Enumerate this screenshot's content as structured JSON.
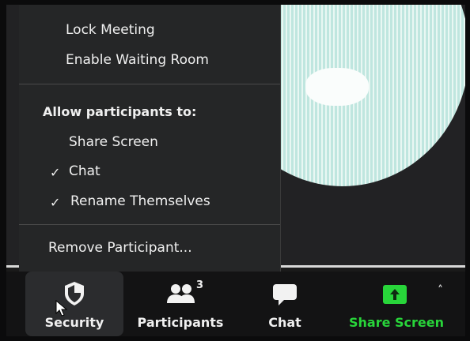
{
  "menu": {
    "lock_meeting": "Lock Meeting",
    "enable_waiting_room": "Enable Waiting Room",
    "allow_heading": "Allow participants to:",
    "share_screen": "Share Screen",
    "chat": "Chat",
    "rename_themselves": "Rename Themselves",
    "remove_participant": "Remove Participant...",
    "checks": {
      "share_screen": false,
      "chat": true,
      "rename_themselves": true
    },
    "check_glyph": "✓"
  },
  "toolbar": {
    "security": {
      "label": "Security",
      "icon": "shield-icon"
    },
    "participants": {
      "label": "Participants",
      "count": "3",
      "icon": "people-icon"
    },
    "chat": {
      "label": "Chat",
      "icon": "speech-bubble-icon"
    },
    "share_screen": {
      "label": "Share Screen",
      "icon": "share-arrow-icon",
      "caret": "˄"
    }
  },
  "colors": {
    "accent_green": "#28d53a",
    "menu_bg": "#252627",
    "toolbar_bg": "#131314"
  }
}
